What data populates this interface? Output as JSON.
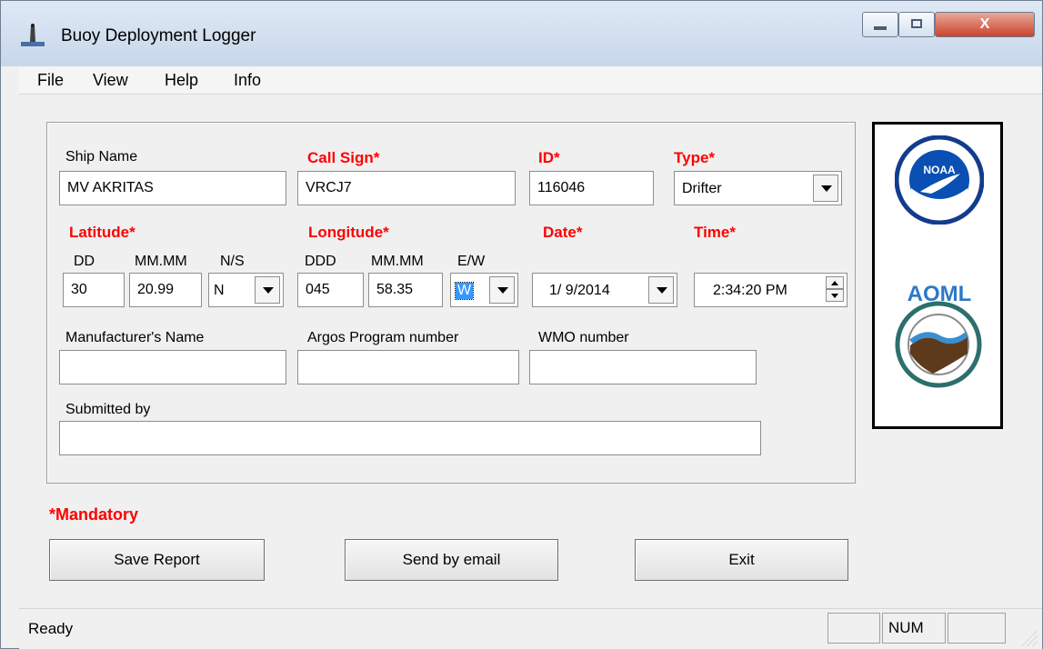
{
  "window": {
    "title": "Buoy Deployment Logger",
    "close_label": "X"
  },
  "menu": [
    "File",
    "View",
    "Help",
    "Info"
  ],
  "form": {
    "ship_name": {
      "label": "Ship Name",
      "value": "MV AKRITAS"
    },
    "call_sign": {
      "label": "Call Sign*",
      "value": "VRCJ7"
    },
    "id": {
      "label": "ID*",
      "value": "116046"
    },
    "type": {
      "label": "Type*",
      "value": "Drifter"
    },
    "latitude": {
      "label": "Latitude*",
      "dd_label": "DD",
      "mm_label": "MM.MM",
      "ns_label": "N/S",
      "dd": "30",
      "mm": "20.99",
      "ns": "N"
    },
    "longitude": {
      "label": "Longitude*",
      "ddd_label": "DDD",
      "mm_label": "MM.MM",
      "ew_label": "E/W",
      "ddd": "045",
      "mm": "58.35",
      "ew": "W"
    },
    "date": {
      "label": "Date*",
      "value": "1/ 9/2014"
    },
    "time": {
      "label": "Time*",
      "value": "2:34:20 PM"
    },
    "manufacturer": {
      "label": "Manufacturer's Name",
      "value": ""
    },
    "argos": {
      "label": "Argos Program number",
      "value": ""
    },
    "wmo": {
      "label": "WMO number",
      "value": ""
    },
    "submitted_by": {
      "label": "Submitted by",
      "value": ""
    }
  },
  "logos": {
    "noaa": "NOAA",
    "aoml": "AOML"
  },
  "mandatory_note": "*Mandatory",
  "buttons": {
    "save": "Save Report",
    "email": "Send by email",
    "exit": "Exit"
  },
  "status": {
    "text": "Ready",
    "num": "NUM"
  },
  "colors": {
    "required_label": "#ff0000",
    "selection": "#3399ff"
  }
}
